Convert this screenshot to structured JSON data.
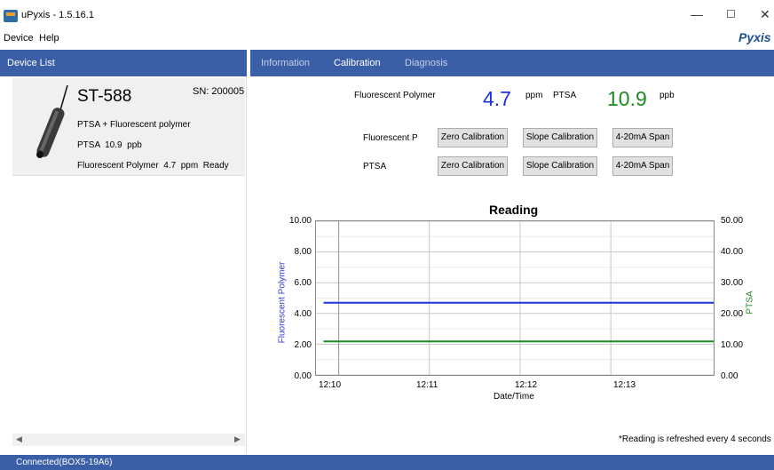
{
  "window": {
    "title": "uPyxis - 1.5.16.1",
    "brand": "Pyxis"
  },
  "menu": [
    {
      "label": "Device"
    },
    {
      "label": "Help"
    }
  ],
  "left_panel": {
    "header": "Device List",
    "device": {
      "name": "ST-588",
      "serial": "SN: 200005",
      "description": "PTSA + Fluorescent polymer",
      "ptsa_line": "PTSA  10.9  ppb",
      "fp_line": "Fluorescent Polymer  4.7  ppm  Ready"
    }
  },
  "tabs": [
    {
      "label": "Information",
      "active": false
    },
    {
      "label": "Calibration",
      "active": true
    },
    {
      "label": "Diagnosis",
      "active": false
    }
  ],
  "readings": {
    "fp_label": "Fluorescent Polymer",
    "fp_value": "4.7",
    "fp_unit": "ppm",
    "ptsa_label": "PTSA",
    "ptsa_value": "10.9",
    "ptsa_unit": "ppb",
    "fp_color": "#1a33e0",
    "ptsa_color": "#1d8a22"
  },
  "calibration": {
    "rows": [
      {
        "label": "Fluorescent P",
        "zero": "Zero Calibration",
        "slope": "Slope Calibration",
        "span": "4-20mA Span"
      },
      {
        "label": "PTSA",
        "zero": "Zero Calibration",
        "slope": "Slope Calibration",
        "span": "4-20mA Span"
      }
    ]
  },
  "chart_data": {
    "type": "line",
    "title": "Reading",
    "xlabel": "Date/Time",
    "ylabel_left": "Fluorescent Polymer",
    "ylabel_right": "PTSA",
    "x_ticks": [
      "12:10",
      "12:11",
      "12:12",
      "12:13"
    ],
    "y_left_ticks": [
      "10.00",
      "8.00",
      "6.00",
      "4.00",
      "2.00",
      "0.00"
    ],
    "y_right_ticks": [
      "50.00",
      "40.00",
      "30.00",
      "20.00",
      "10.00",
      "0.00"
    ],
    "ylim_left": [
      0,
      10
    ],
    "ylim_right": [
      0,
      50
    ],
    "grid": true,
    "series": [
      {
        "name": "Fluorescent Polymer",
        "axis": "left",
        "color": "#1a33e0",
        "x": [
          "12:09:50",
          "12:14:15"
        ],
        "values": [
          4.7,
          4.7
        ]
      },
      {
        "name": "PTSA",
        "axis": "right",
        "color": "#1d8a22",
        "x": [
          "12:09:50",
          "12:14:15"
        ],
        "values": [
          10.9,
          10.9
        ]
      }
    ]
  },
  "footnote": "*Reading is refreshed every 4 seconds",
  "status": "Connected(BOX5-19A6)"
}
